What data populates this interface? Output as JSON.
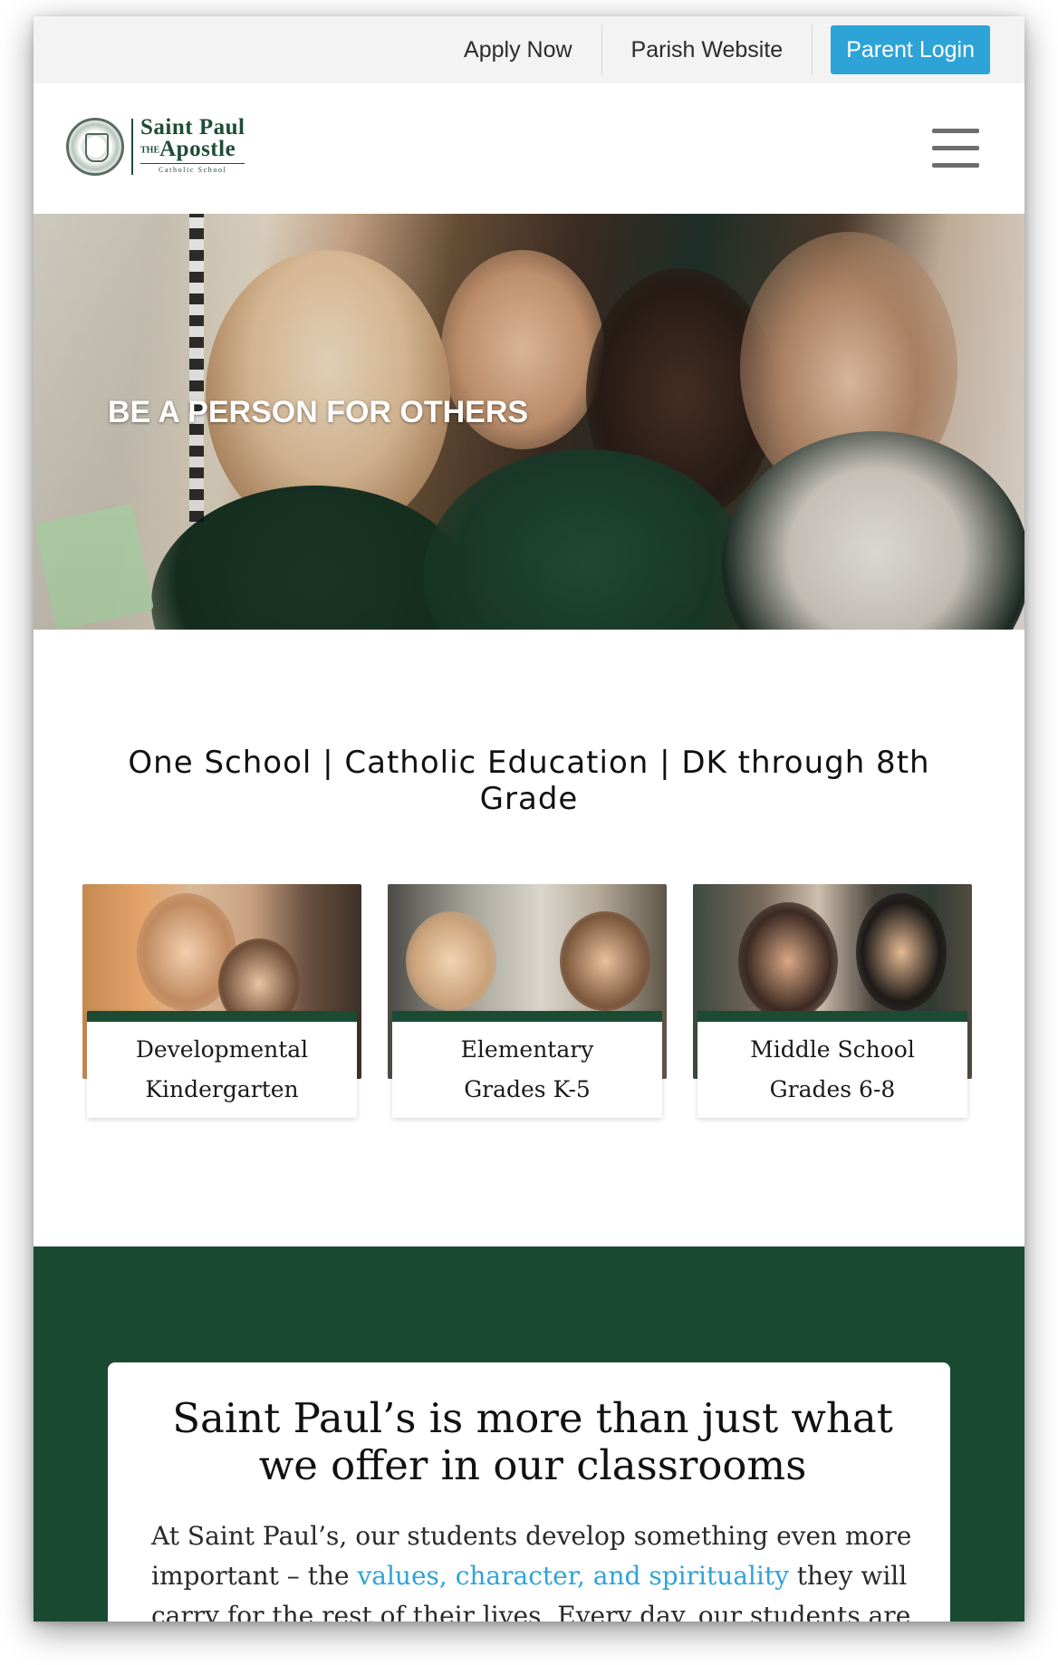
{
  "topbar": {
    "apply_label": "Apply Now",
    "parish_label": "Parish Website",
    "login_label": "Parent Login"
  },
  "logo": {
    "line1": "Saint Paul",
    "line2_prefix": "THE",
    "line2": "Apostle",
    "line3": "Catholic School"
  },
  "hero": {
    "title": "BE A PERSON FOR OTHERS"
  },
  "tagline": "One School | Catholic Education | DK through 8th Grade",
  "programs": [
    {
      "line1": "Developmental",
      "line2": "Kindergarten"
    },
    {
      "line1": "Elementary",
      "line2": "Grades K-5"
    },
    {
      "line1": "Middle School",
      "line2": "Grades 6-8"
    }
  ],
  "about": {
    "heading": "Saint Paul’s is more than just what we offer in our classrooms",
    "text_before": "At Saint Paul’s, our students develop something even more important – the ",
    "link_text": "values, character, and spirituality",
    "text_after": " they will carry for the rest of their lives. Every day, our students are"
  },
  "colors": {
    "brand_green": "#1b4a33",
    "accent_blue": "#2ea3d8",
    "topbar_bg": "#f3f3f3"
  },
  "icons": {
    "menu": "hamburger-icon",
    "logo": "school-seal-icon"
  }
}
